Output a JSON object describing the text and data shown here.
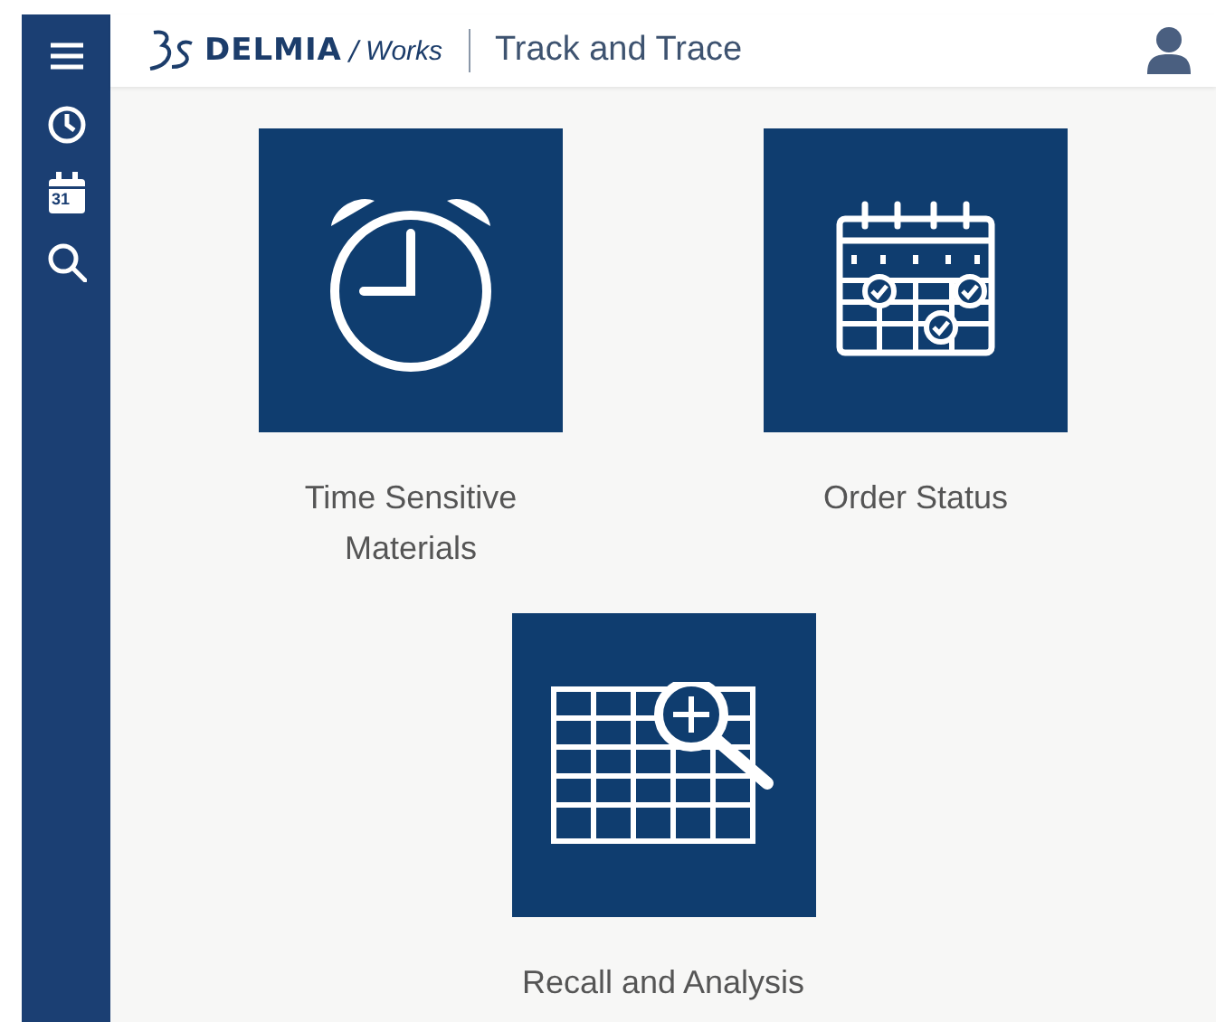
{
  "sidebar": {
    "calendar_day": "31"
  },
  "header": {
    "brand": "DELMIA",
    "separator": "/",
    "product": "Works",
    "title": "Track and Trace"
  },
  "tiles": [
    {
      "kind": "alarm",
      "label": "Time Sensitive Materials"
    },
    {
      "kind": "calendar",
      "label": "Order Status"
    },
    {
      "kind": "table",
      "label": "Recall and Analysis"
    }
  ]
}
